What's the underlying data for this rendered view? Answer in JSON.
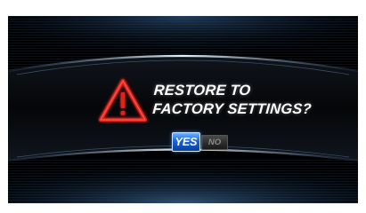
{
  "dialog": {
    "line1": "RESTORE TO",
    "line2": "FACTORY SETTINGS?",
    "icon": "warning-triangle-icon"
  },
  "buttons": {
    "yes_label": "YES",
    "no_label": "NO",
    "selected": "YES"
  },
  "colors": {
    "background": "#000000",
    "warning_red": "#e0201a",
    "accent_blue": "#1a62d6",
    "arc_highlight": "#d8e6f5"
  }
}
